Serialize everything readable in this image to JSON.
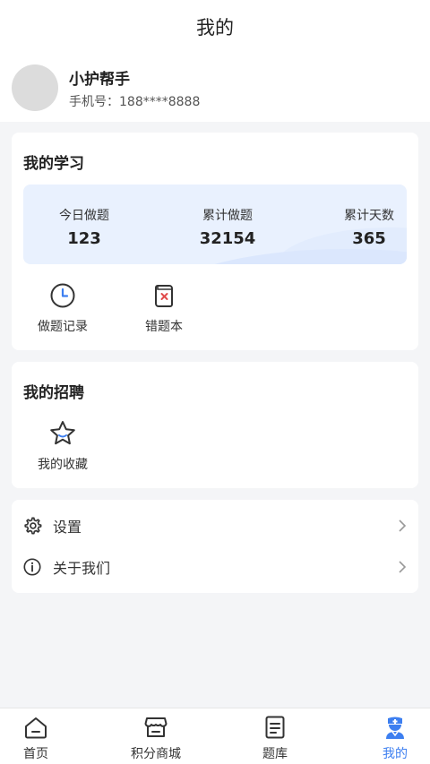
{
  "header": {
    "title": "我的"
  },
  "profile": {
    "name": "小护帮手",
    "phone": "手机号：188****8888"
  },
  "study": {
    "title": "我的学习",
    "stats": [
      {
        "label": "今日做题",
        "value": "123"
      },
      {
        "label": "累计做题",
        "value": "32154"
      },
      {
        "label": "累计天数",
        "value": "365"
      }
    ],
    "tools": [
      {
        "label": "做题记录",
        "icon": "clock-icon"
      },
      {
        "label": "错题本",
        "icon": "wrong-book-icon"
      }
    ]
  },
  "recruit": {
    "title": "我的招聘",
    "tools": [
      {
        "label": "我的收藏",
        "icon": "star-icon"
      }
    ]
  },
  "settings": {
    "items": [
      {
        "label": "设置",
        "icon": "gear-icon"
      },
      {
        "label": "关于我们",
        "icon": "info-icon"
      }
    ]
  },
  "tabbar": {
    "items": [
      {
        "label": "首页",
        "icon": "home-icon"
      },
      {
        "label": "积分商城",
        "icon": "store-icon"
      },
      {
        "label": "题库",
        "icon": "document-icon"
      },
      {
        "label": "我的",
        "icon": "nurse-icon",
        "active": true
      }
    ],
    "active_color": "#3d7ff0"
  },
  "colors": {
    "accent": "#3d7ff0",
    "stats_bg": "#e9f1fe",
    "page_bg": "#f4f5f7"
  }
}
